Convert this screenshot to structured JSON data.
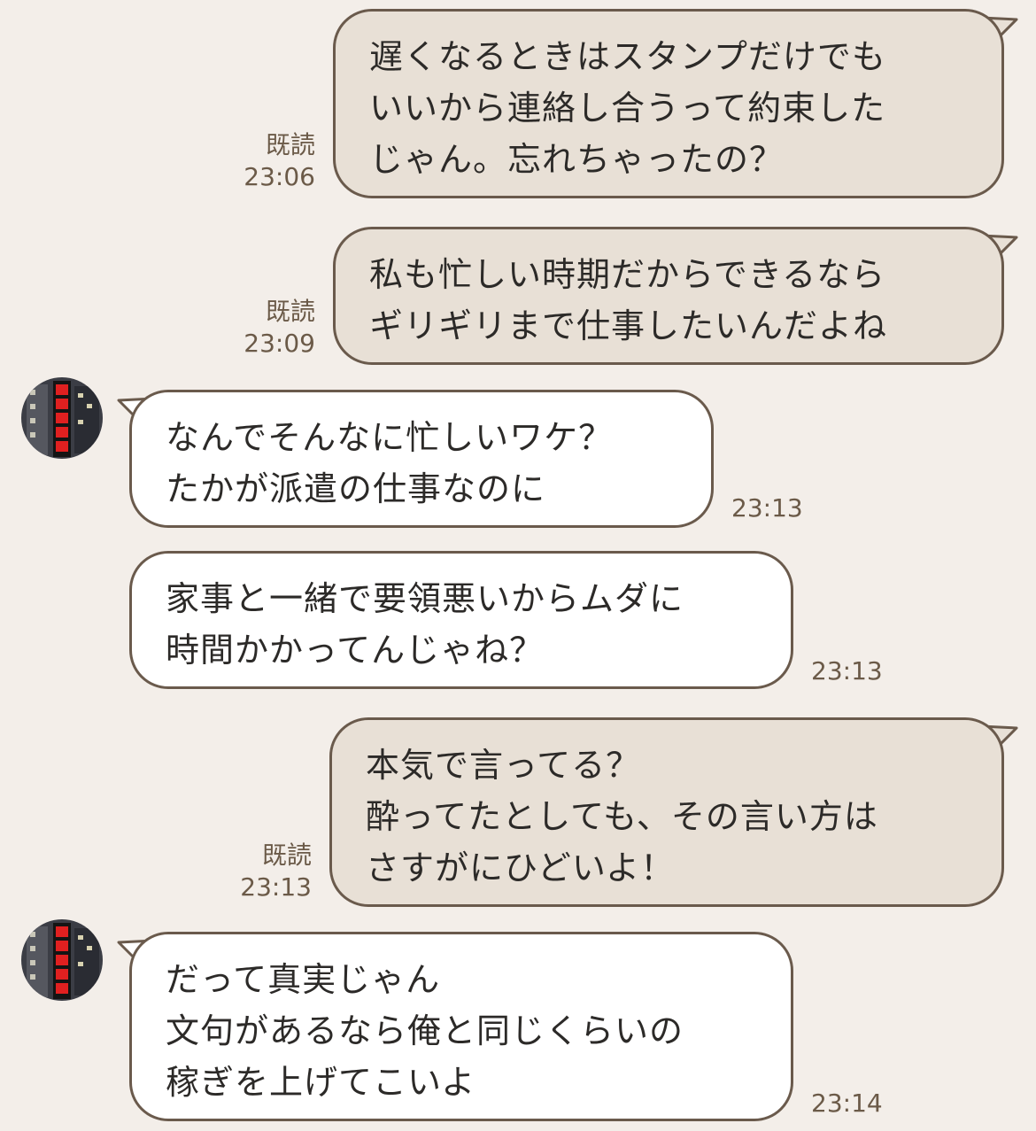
{
  "colors": {
    "background": "#f3eee9",
    "sent_bubble": "#e8e0d6",
    "received_bubble": "#ffffff",
    "bubble_border": "#6a5a4c",
    "meta_text": "#6b5a48",
    "avatar_accent": "#e02020"
  },
  "messages": [
    {
      "direction": "sent",
      "lines": [
        "遅くなるときはスタンプだけでも",
        "いいから連絡し合うって約束した",
        "じゃん。忘れちゃったの？"
      ],
      "read": "既読",
      "time": "23:06"
    },
    {
      "direction": "sent",
      "lines": [
        "私も忙しい時期だからできるなら",
        "ギリギリまで仕事したいんだよね"
      ],
      "read": "既読",
      "time": "23:09"
    },
    {
      "direction": "received",
      "lines": [
        "なんでそんなに忙しいワケ？",
        "たかが派遣の仕事なのに"
      ],
      "time": "23:13",
      "avatar": "avatar-icon"
    },
    {
      "direction": "received",
      "lines": [
        "家事と一緒で要領悪いからムダに",
        "時間かかってんじゃね？"
      ],
      "time": "23:13"
    },
    {
      "direction": "sent",
      "lines": [
        "本気で言ってる？",
        "酔ってたとしても、その言い方は",
        "さすがにひどいよ！"
      ],
      "read": "既読",
      "time": "23:13"
    },
    {
      "direction": "received",
      "lines": [
        "だって真実じゃん",
        "文句があるなら俺と同じくらいの",
        "稼ぎを上げてこいよ"
      ],
      "time": "23:14",
      "avatar": "avatar-icon"
    }
  ]
}
